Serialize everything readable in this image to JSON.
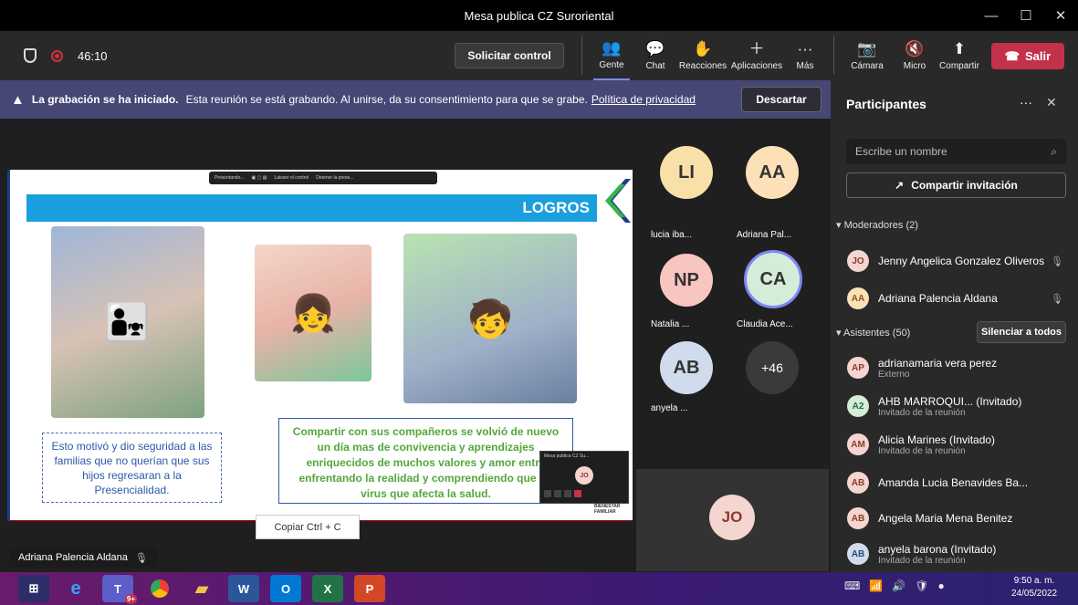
{
  "window": {
    "title": "Mesa publica CZ Suroriental",
    "minimize": "—",
    "maximize": "☐",
    "close": "✕"
  },
  "meeting": {
    "timer": "46:10",
    "request_control": "Solicitar control",
    "controls": [
      {
        "label": "Gente",
        "glyph": "👥"
      },
      {
        "label": "Chat",
        "glyph": "💬"
      },
      {
        "label": "Reacciones",
        "glyph": "✋"
      },
      {
        "label": "Aplicaciones",
        "glyph": "＋"
      },
      {
        "label": "Más",
        "glyph": "···"
      }
    ],
    "av": [
      {
        "label": "Cámara",
        "glyph": "📷"
      },
      {
        "label": "Micro",
        "glyph": "🔇"
      },
      {
        "label": "Compartir",
        "glyph": "⬆"
      }
    ],
    "leave": "Salir"
  },
  "banner": {
    "bold": "La grabación se ha iniciado.",
    "text": "Esta reunión se está grabando. Al unirse, da su consentimiento para que se grabe.",
    "link": "Política de privacidad",
    "dismiss": "Descartar"
  },
  "slide": {
    "toolbar": "Presentando...",
    "toolbar_b": "Laisser el control",
    "toolbar_c": "Detener la prese...",
    "title": "LOGROS",
    "caption_left": "Esto motivó y dio seguridad a las familias que no querían que sus hijos regresaran a la Presencialidad.",
    "caption_center": "Compartir con sus compañeros se volvió de nuevo un día mas de convivencia y aprendizajes enriquecidos de muchos valores y amor entre enfrentando la realidad y comprendiendo que un virus que afecta la salud.",
    "mini_title": "Mesa publica CZ Su...",
    "mini_time": "46:10",
    "mini_initials": "JO",
    "logo": "BIENESTAR FAMILIAR"
  },
  "copy_tooltip": "Copiar  Ctrl + C",
  "speaker": "Adriana Palencia Aldana",
  "tiles": [
    {
      "initials": "LI",
      "name": "lucia iba...",
      "bg": "#f9e0a8"
    },
    {
      "initials": "AA",
      "name": "Adriana Pal...",
      "bg": "#fce0b8"
    },
    {
      "initials": "NP",
      "name": "Natalia ...",
      "bg": "#f7c6c0"
    },
    {
      "initials": "CA",
      "name": "Claudia Ace...",
      "bg": "#d4ecd8"
    },
    {
      "initials": "AB",
      "name": "anyela ...",
      "bg": "#d0dced"
    },
    {
      "initials": "+46",
      "name": "",
      "bg": "#3a3a3a"
    }
  ],
  "self_tile": "JO",
  "participants": {
    "title": "Participantes",
    "search_placeholder": "Escribe un nombre",
    "share": "Compartir invitación",
    "moderators_label": "Moderadores (2)",
    "moderators": [
      {
        "initials": "JO",
        "name": "Jenny Angelica Gonzalez Oliveros"
      },
      {
        "initials": "AA",
        "name": "Adriana Palencia Aldana"
      }
    ],
    "attendees_label": "Asistentes (50)",
    "mute_all": "Silenciar a todos",
    "attendees": [
      {
        "initials": "AP",
        "name": "adrianamaria vera perez",
        "sub": "Externo"
      },
      {
        "initials": "A2",
        "name": "AHB MARROQUI... (Invitado)",
        "sub": "Invitado de la reunión"
      },
      {
        "initials": "AM",
        "name": "Alicia Marines (Invitado)",
        "sub": "Invitado de la reunión"
      },
      {
        "initials": "AB",
        "name": "Amanda Lucia Benavides Ba...",
        "sub": ""
      },
      {
        "initials": "AB",
        "name": "Angela Maria Mena Benitez",
        "sub": ""
      },
      {
        "initials": "AB",
        "name": "anyela barona (Invitado)",
        "sub": "Invitado de la reunión"
      }
    ]
  },
  "taskbar": {
    "time": "9:50 a. m.",
    "date": "24/05/2022",
    "badge": "9+"
  }
}
